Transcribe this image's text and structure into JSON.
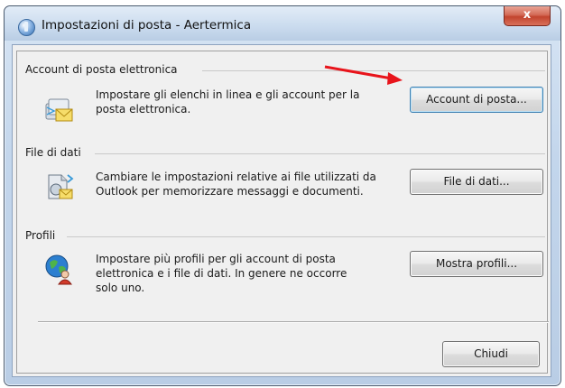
{
  "window": {
    "title": "Impostazioni di posta - Aertermica",
    "close_label": "x"
  },
  "sections": [
    {
      "label": "Account di posta elettronica",
      "description_lines": [
        "Impostare gli elenchi in linea e gli account per la",
        "posta elettronica."
      ],
      "button": "Account di posta..."
    },
    {
      "label": "File di dati",
      "description_lines": [
        "Cambiare le impostazioni relative ai file utilizzati da",
        "Outlook per memorizzare messaggi e documenti."
      ],
      "button": "File di dati..."
    },
    {
      "label": "Profili",
      "description_lines": [
        "Impostare più profili per gli account di posta",
        "elettronica e i file di dati. In genere ne occorre",
        "solo uno."
      ],
      "button": "Mostra profili..."
    }
  ],
  "footer": {
    "close_button": "Chiudi"
  },
  "colors": {
    "annotation_arrow": "#e8141b"
  }
}
